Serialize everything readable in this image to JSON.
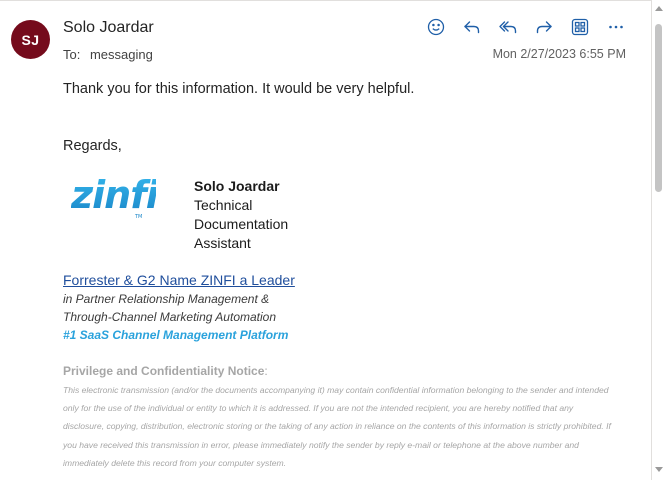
{
  "header": {
    "avatar_initials": "SJ",
    "sender": "Solo Joardar",
    "to_label": "To:",
    "to_value": "messaging",
    "date": "Mon 2/27/2023 6:55 PM",
    "actions": [
      "emoji-icon",
      "reply-icon",
      "reply-all-icon",
      "forward-icon",
      "apps-icon",
      "more-icon"
    ],
    "avatar_color": "#750b1c",
    "icon_color": "#1f5fa8"
  },
  "body": {
    "line1": "Thank you for this information. It would be very helpful.",
    "regards": "Regards,"
  },
  "signature": {
    "logo_text": "zinfi",
    "logo_tm": "TM",
    "name": "Solo Joardar",
    "title_lines": [
      "Technical",
      "Documentation",
      "Assistant"
    ],
    "link": "Forrester & G2 Name ZINFI a Leader",
    "tagline1": "in Partner Relationship Management &",
    "tagline2": "Through-Channel Marketing Automation",
    "tagline3": "#1 SaaS Channel Management Platform"
  },
  "notice": {
    "title": "Privilege and Confidentiality Notice",
    "colon": ":",
    "lines": [
      "This electronic transmission (and/or the documents accompanying it) may contain confidential information belonging to the sender and intended",
      "only for the use of the individual or entity to which it is addressed. If you are not the intended recipient, you are hereby notified that any",
      "disclosure, copying, distribution, electronic storing or the taking of any action in reliance on the contents of this information is strictly prohibited. If",
      "you have received this transmission in error, please immediately notify the sender by reply e-mail or telephone at the above number and",
      "immediately delete this record from your computer system."
    ]
  }
}
